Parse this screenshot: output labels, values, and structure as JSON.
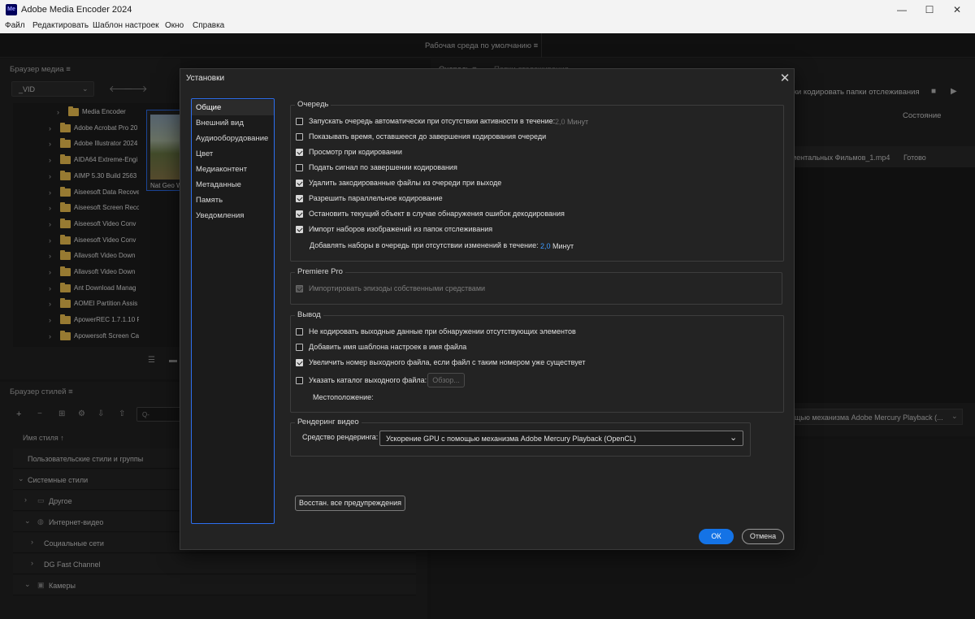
{
  "app": {
    "title": "Adobe Media Encoder 2024",
    "logo_text": "Me"
  },
  "window_controls": {
    "minimize": "—",
    "maximize": "☐",
    "close": "✕"
  },
  "menu": [
    "Файл",
    "Редактировать",
    "Шаблон настроек",
    "Окно",
    "Справка"
  ],
  "workspace_label": "Рабочая среда по умолчанию ≡",
  "media_browser": {
    "title": "Браузер медиа ≡",
    "path_select": "_VID",
    "folders": [
      "Media Encoder",
      "Adobe Acrobat Pro 20",
      "Adobe Illustrator 2024",
      "AIDA64 Extreme-Engi",
      "AIMP 5.30 Build 2563",
      "Aiseesoft Data Recove",
      "Aiseesoft Screen Reco",
      "Aiseesoft Video Conv",
      "Aiseesoft Video Conv",
      "Allavsoft Video Down",
      "Allavsoft Video Down",
      "Ant Download Manag",
      "AOMEI Partition Assis",
      "ApowerREC 1.7.1.10 Re",
      "Apowersoft Screen Ca"
    ],
    "thumb_label": "Nat Geo W"
  },
  "style_browser": {
    "title": "Браузер стилей ≡",
    "search_placeholder": "Q-",
    "column_header": "Имя стиля ↑",
    "rows": [
      "Пользовательские стили и группы",
      "Системные стили",
      "Другое",
      "Интернет-видео",
      "Социальные сети",
      "DG Fast Channel",
      "Камеры"
    ]
  },
  "queue_panel": {
    "tabs": [
      "Очередь ≡",
      "Папки отслеживания"
    ],
    "watch_label": "ски кодировать папки отслеживания",
    "status_header": "Состояние",
    "row_file": "ментальных Фильмов_1.mp4",
    "row_status": "Готово",
    "renderer_label": "ощью механизма Adobe Mercury Playback (..."
  },
  "dialog": {
    "title": "Установки",
    "close": "✕",
    "categories": [
      "Общие",
      "Внешний вид",
      "Аудиооборудование",
      "Цвет",
      "Медиаконтент",
      "Метаданные",
      "Память",
      "Уведомления"
    ],
    "queue": {
      "legend": "Очередь",
      "auto_start": "Запускать очередь автоматически при отсутствии активности в течение:",
      "auto_start_value": "2,0",
      "auto_start_unit": "Минут",
      "show_time": "Показывать время, оставшееся до завершения кодирования очереди",
      "preview": "Просмотр при кодировании",
      "beep": "Подать сигнал по завершении кодирования",
      "remove": "Удалить закодированные файлы из очереди при выходе",
      "parallel": "Разрешить параллельное кодирование",
      "stop_on_error": "Остановить текущий объект в случае обнаружения ошибок декодирования",
      "import_sequences": "Импорт наборов изображений из папок отслеживания",
      "add_sets": "Добавлять наборы в очередь при отсутствии изменений в течение:",
      "add_sets_value": "2,0",
      "add_sets_unit": "Минут"
    },
    "premiere": {
      "legend": "Premiere Pro",
      "native_import": "Импортировать эпизоды собственными средствами"
    },
    "output": {
      "legend": "Вывод",
      "no_missing": "Не кодировать выходные данные при обнаружении отсутствующих элементов",
      "add_preset_name": "Добавить имя шаблона настроек в имя файла",
      "increment": "Увеличить номер выходного файла, если файл с таким номером уже существует",
      "specify_dir": "Указать каталог выходного файла:",
      "browse": "Обзор...",
      "location": "Местоположение:"
    },
    "render": {
      "legend": "Рендеринг видео",
      "label": "Средство рендеринга:",
      "value": "Ускорение GPU с помощью механизма Adobe Mercury Playback (OpenCL)"
    },
    "reset_warnings": "Восстан. все предупреждения",
    "ok": "ОК",
    "cancel": "Отмена"
  },
  "colors": {
    "accent": "#1473e6",
    "link_value": "#3f9bff",
    "folder": "#f4c651"
  }
}
